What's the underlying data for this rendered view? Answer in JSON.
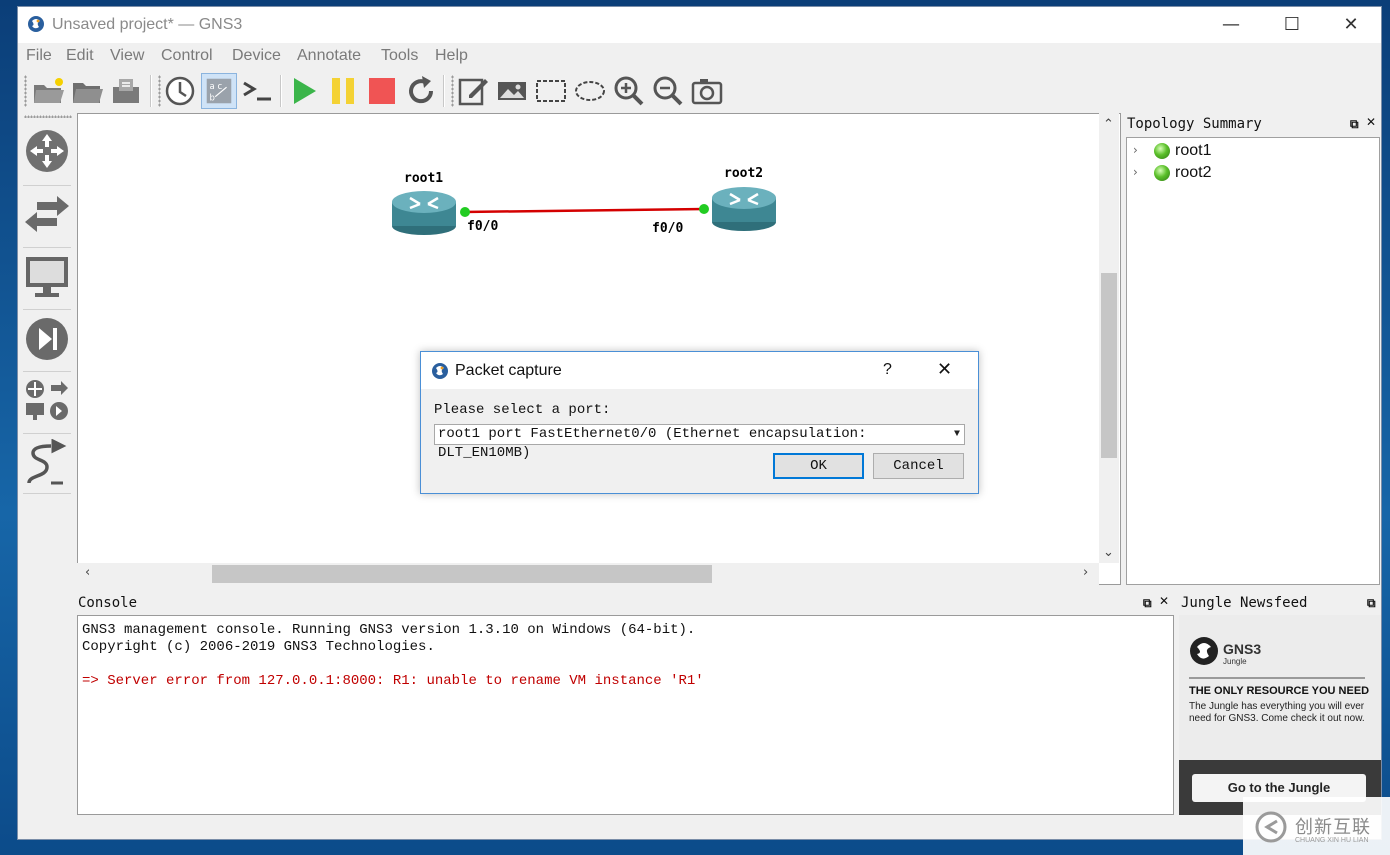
{
  "window": {
    "title": "Unsaved project* — GNS3",
    "minimize": "—",
    "maximize": "☐",
    "close": "✕"
  },
  "menu": [
    "File",
    "Edit",
    "View",
    "Control",
    "Device",
    "Annotate",
    "Tools",
    "Help"
  ],
  "toolbar_icons": [
    "new-project-icon",
    "open-project-icon",
    "save-project-icon",
    "snapshot-clock-icon",
    "show-interface-labels-icon",
    "console-all-icon",
    "start-all-icon",
    "suspend-all-icon",
    "stop-all-icon",
    "reload-all-icon",
    "add-note-icon",
    "insert-image-icon",
    "draw-rectangle-icon",
    "draw-ellipse-icon",
    "zoom-in-icon",
    "zoom-out-icon",
    "screenshot-icon"
  ],
  "device_types": [
    "routers-icon",
    "switches-icon",
    "end-devices-icon",
    "security-devices-icon",
    "all-devices-icon",
    "add-link-icon"
  ],
  "topology": {
    "nodes": [
      {
        "name": "root1",
        "port": "f0/0"
      },
      {
        "name": "root2",
        "port": "f0/0"
      }
    ],
    "link_color": "#d40000",
    "port_color": "#22cc22"
  },
  "topology_summary": {
    "title": "Topology Summary",
    "items": [
      {
        "name": "root1",
        "status": "started"
      },
      {
        "name": "root2",
        "status": "started"
      }
    ]
  },
  "console": {
    "title": "Console",
    "lines": [
      "GNS3 management console. Running GNS3 version 1.3.10 on Windows (64-bit).",
      "Copyright (c) 2006-2019 GNS3 Technologies.",
      "",
      "=> Server error from 127.0.0.1:8000: R1: unable to rename VM instance 'R1'"
    ]
  },
  "jungle": {
    "title": "Jungle Newsfeed",
    "brand": "GNS3",
    "brand_sub": "Jungle",
    "headline": "THE ONLY RESOURCE YOU NEED",
    "body": "The Jungle has everything you will ever need for GNS3. Come check it out now.",
    "button": "Go to the Jungle"
  },
  "dialog": {
    "title": "Packet capture",
    "help": "?",
    "close": "✕",
    "label": "Please select a port:",
    "selected_port": "root1 port FastEthernet0/0 (Ethernet encapsulation: DLT_EN10MB)",
    "ok": "OK",
    "cancel": "Cancel"
  },
  "watermark": {
    "cn": "创新互联",
    "en": "CHUANG XIN HU LIAN"
  },
  "colors": {
    "accent": "#0078d7",
    "error_text": "#c00000"
  }
}
